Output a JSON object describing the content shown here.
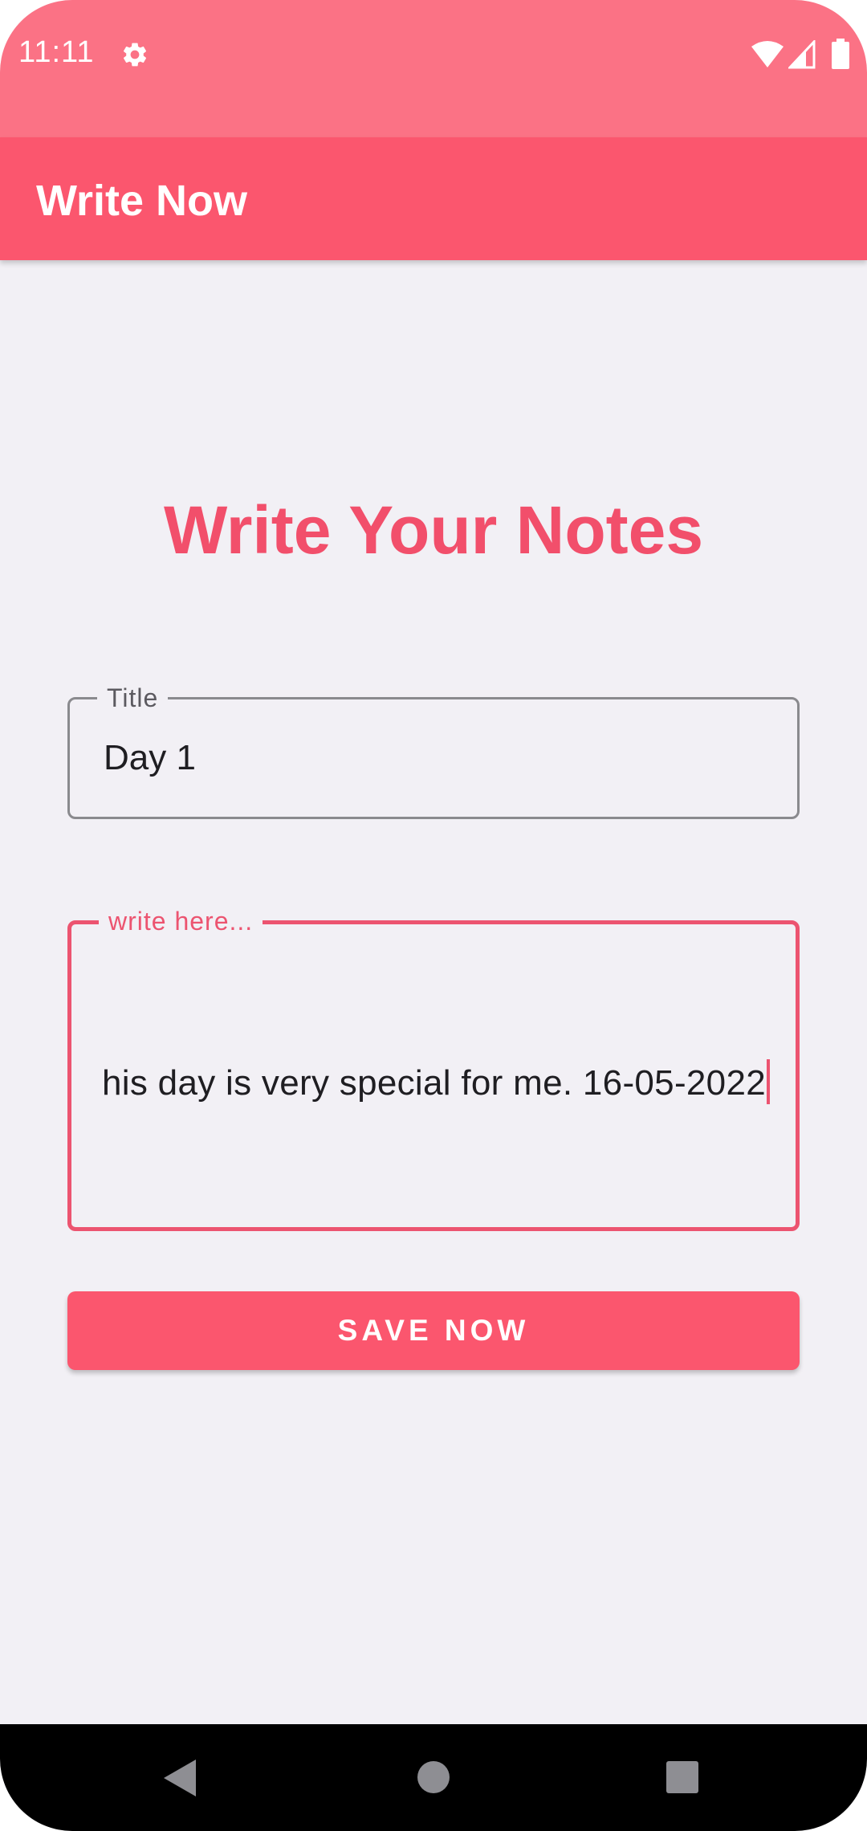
{
  "status_bar": {
    "time": "11:11",
    "icons": [
      "gear-icon",
      "wifi-icon",
      "signal-icon",
      "battery-icon"
    ]
  },
  "app_bar": {
    "title": "Write Now"
  },
  "main": {
    "heading": "Write Your Notes",
    "title_field": {
      "label": "Title",
      "value": "Day 1"
    },
    "notes_field": {
      "label": "write here...",
      "value": "his day is very special for me. 16-05-2022"
    },
    "save_button": {
      "label": "SAVE NOW"
    }
  },
  "nav_bar": {
    "icons": [
      "back-icon",
      "home-icon",
      "recents-icon"
    ]
  },
  "colors": {
    "status_bar": "#FB7285",
    "app_bar": "#FB566E",
    "accent": "#F24F6B",
    "background": "#F2F0F5",
    "text": "#1F1E22"
  }
}
